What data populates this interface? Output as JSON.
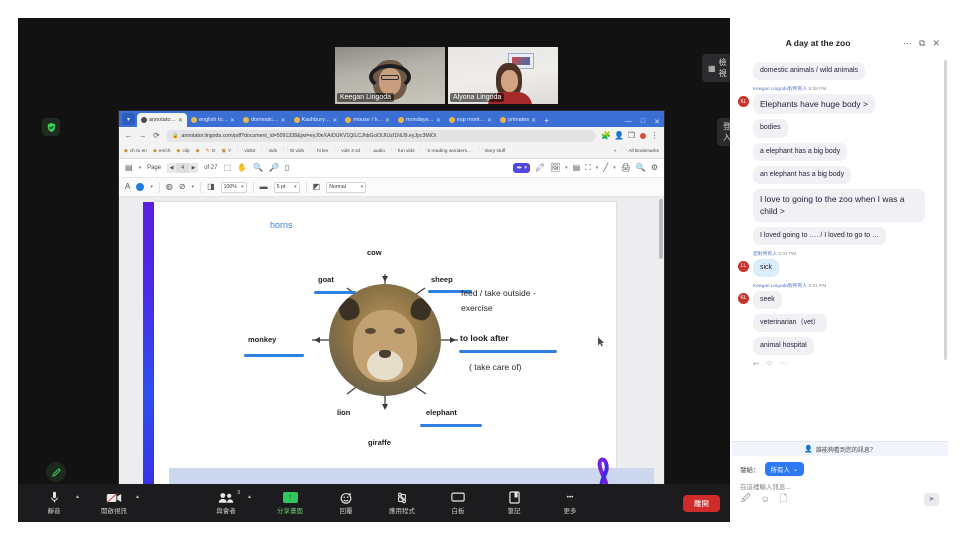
{
  "meeting": {
    "view_pill": "檢視",
    "signin_pill": "登入",
    "tiles": [
      {
        "name": "Keegan Lingoda",
        "active": true
      },
      {
        "name": "Alyona Lingoda",
        "active": false
      }
    ],
    "rail": {
      "shield_icon": "shield-check-icon",
      "pencil_icon": "annotate-pencil-icon"
    },
    "toolbar": [
      {
        "label": "靜音",
        "icon": "microphone-icon",
        "caret": true
      },
      {
        "label": "開啟視訊",
        "icon": "video-off-icon",
        "caret": true
      },
      {
        "label": "與會者",
        "icon": "participants-icon",
        "caret": true,
        "badge": "3"
      },
      {
        "label": "分享畫面",
        "icon": "share-screen-icon",
        "highlight": true
      },
      {
        "label": "回覆",
        "icon": "reactions-icon"
      },
      {
        "label": "應用程式",
        "icon": "apps-icon"
      },
      {
        "label": "白板",
        "icon": "whiteboard-icon"
      },
      {
        "label": "筆記",
        "icon": "notes-icon"
      },
      {
        "label": "更多",
        "icon": "more-dots-icon"
      }
    ],
    "leave_button": "離開"
  },
  "browser": {
    "tabs": [
      {
        "label": "annotato…",
        "selected": true
      },
      {
        "label": "english to…",
        "selected": false
      },
      {
        "label": "domestic…",
        "selected": false
      },
      {
        "label": "Kashbury…",
        "selected": false
      },
      {
        "label": "mouse / h…",
        "selected": false
      },
      {
        "label": "mondays…",
        "selected": false
      },
      {
        "label": "esp mont…",
        "selected": false
      },
      {
        "label": "primates",
        "selected": false
      }
    ],
    "new_tab": "+",
    "window_controls": [
      "—",
      "□",
      "✕"
    ],
    "nav": {
      "back": "←",
      "forward": "→",
      "reload": "⟳"
    },
    "url": "annotator.lingoda.com/pdf?document_id=5091338&jwt=eyJ0eXAiOiJKV1QiLCJhbGciOiJIUzI1NiJ9.eyJpc3MiOi",
    "bookmarks": [
      "ch to en",
      "en/ch",
      "clip",
      "",
      "O",
      "Y",
      "vids2",
      "vids",
      "tb vids",
      "hi lev",
      "vids 3 sd",
      "audio",
      "fun vids",
      "0 reading wonders…",
      "story stuff"
    ],
    "all_bookmarks": "All Bookmarks"
  },
  "pdf_toolbar": {
    "page_label": "Page",
    "page_current": "4",
    "page_of": "of 27",
    "prev": "◀",
    "next": "▶",
    "tools": [
      "select-icon",
      "pan-hand-icon",
      "zoom-out-icon",
      "zoom-in-icon",
      "page-fit-icon"
    ],
    "right_tools": [
      "pen-tool-icon",
      "highlighter-icon",
      "image-icon",
      "stamp-icon",
      "shape-icon",
      "line-icon",
      "print-icon",
      "search-icon",
      "settings-gear-icon"
    ]
  },
  "annotation_toolbar": {
    "font_icon": "text-format-icon",
    "color_swatch_hex": "#1f7ae0",
    "fill_icon": "fill-bucket-icon",
    "stroke_icon": "no-stroke-icon",
    "opacity_icon": "opacity-icon",
    "opacity_value": "100%",
    "width_icon": "line-width-icon",
    "width_value": "5 pt",
    "blend_icon": "blend-mode-icon",
    "blend_value": "Normal"
  },
  "pdf_page": {
    "mindmap": {
      "center_image": "lion-photo",
      "labels": [
        "cow",
        "sheep",
        "goat",
        "monkey",
        "lion",
        "giraffe",
        "elephant"
      ],
      "annotations": {
        "horns": "horns",
        "feed_line": "feed / take outside -",
        "exercise": "exercise",
        "look_after": "to look after",
        "take_care": "( take care of)"
      },
      "underline_color": "#2f7fe0"
    },
    "left_bar_gradient": [
      "#5a1fe0",
      "#2d4ff0"
    ],
    "cursor": "mouse-cursor"
  },
  "chat": {
    "title": "A day at the zoo",
    "header_icons": [
      "more-options-icon",
      "popout-icon",
      "close-icon"
    ],
    "messages": [
      {
        "avatar": "",
        "sender": "",
        "time": "",
        "text": "domestic animals / wild animals",
        "style": "plain"
      },
      {
        "avatar": "KL",
        "sender": "Keegan Lingoda對所有人",
        "time": "5:28 PM",
        "text": "Elephants have  huge body >",
        "style": "large"
      },
      {
        "avatar": "",
        "sender": "",
        "time": "",
        "text": "bodies",
        "style": "plain"
      },
      {
        "avatar": "",
        "sender": "",
        "time": "",
        "text": "a elephant has a big body",
        "style": "plain"
      },
      {
        "avatar": "",
        "sender": "",
        "time": "",
        "text": "an elephant has a big body",
        "style": "plain"
      },
      {
        "avatar": "",
        "sender": "",
        "time": "",
        "text": "I love to going to the zoo when I was a child >",
        "style": "large"
      },
      {
        "avatar": "",
        "sender": "",
        "time": "",
        "text": "I loved going  to …. /  I loved to go to …",
        "style": "plain"
      },
      {
        "avatar": "LL",
        "sender": "您對所有人",
        "time": "5:31 PM",
        "text": "sick",
        "style": "blue"
      },
      {
        "avatar": "KL",
        "sender": "Keegan Lingoda對所有人",
        "time": "5:31 PM",
        "text": "seek",
        "style": "plain"
      },
      {
        "avatar": "",
        "sender": "",
        "time": "",
        "text": "veterinarian（vet）",
        "style": "plain"
      },
      {
        "avatar": "",
        "sender": "",
        "time": "",
        "text": "animal hospital",
        "style": "plain"
      }
    ],
    "reactions": [
      "reply-icon",
      "emoji-icon",
      "more-dots-icon"
    ],
    "visibility_note": "誰能夠看到您的訊息？",
    "send_to_label": "發給：",
    "send_to_value": "所有人",
    "input_placeholder": "在這裡輸入訊息...",
    "compose_tools": [
      "format-text-icon",
      "emoji-icon",
      "file-attach-icon"
    ],
    "send_button": "send-icon"
  }
}
